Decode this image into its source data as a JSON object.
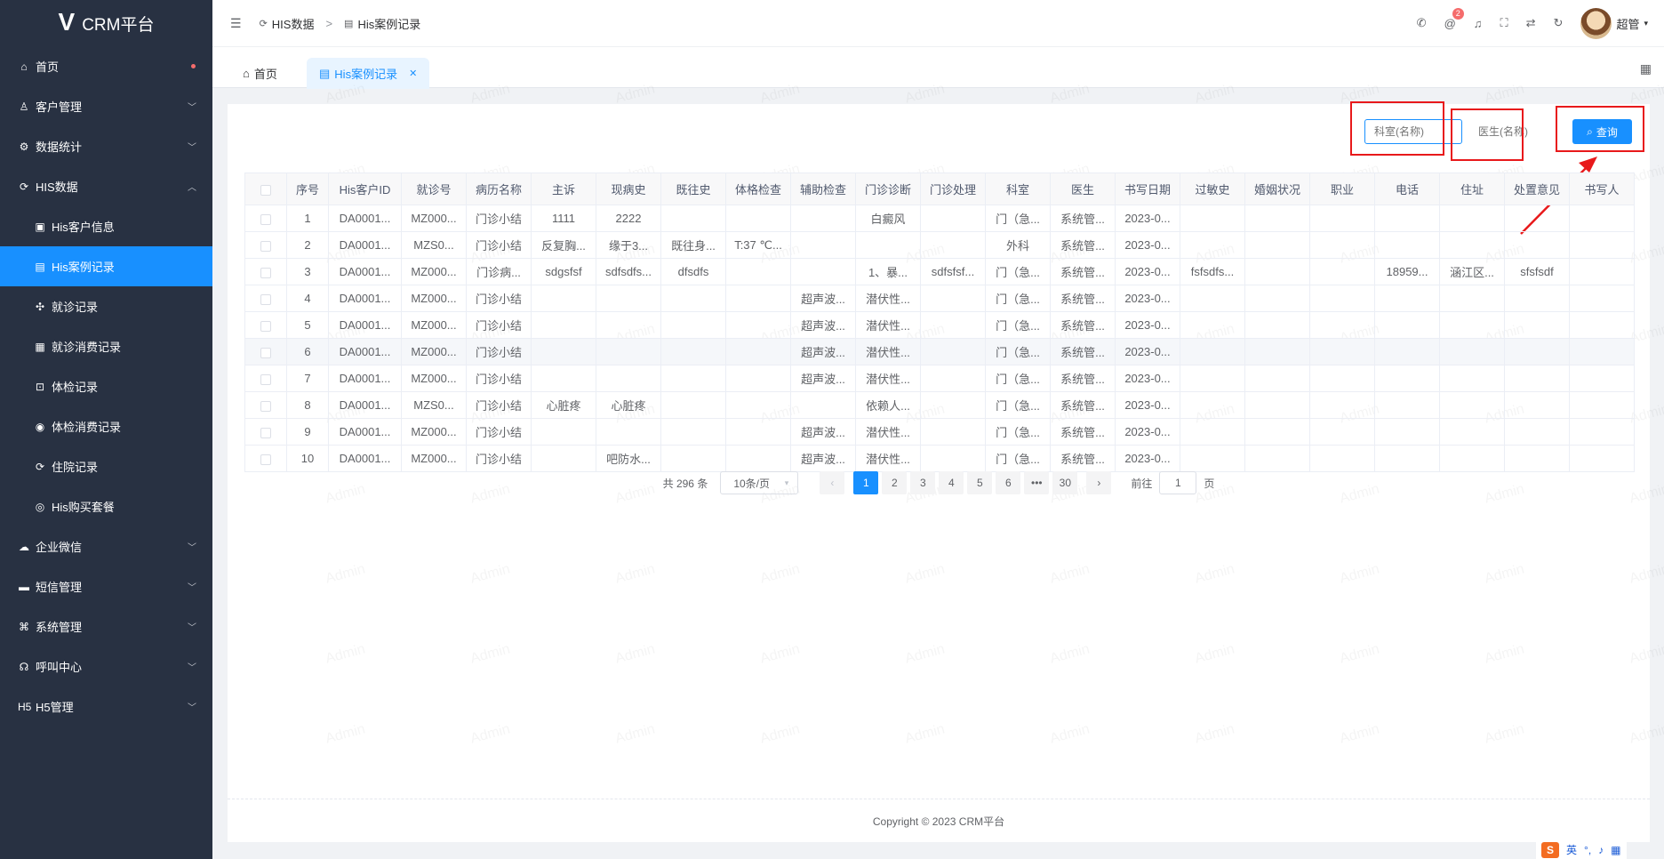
{
  "app": {
    "logo_text": "CRM平台"
  },
  "sidebar": {
    "items": [
      {
        "label": "首页",
        "icon": "home-icon",
        "glyph": "⌂",
        "arrow": "",
        "dot": true,
        "sub": false,
        "active": false
      },
      {
        "label": "客户管理",
        "icon": "user-icon",
        "glyph": "♙",
        "arrow": "down",
        "sub": false,
        "active": false
      },
      {
        "label": "数据统计",
        "icon": "gear-icon",
        "glyph": "⚙",
        "arrow": "down",
        "sub": false,
        "active": false
      },
      {
        "label": "HIS数据",
        "icon": "sync-icon",
        "glyph": "⟳",
        "arrow": "up",
        "sub": false,
        "active": false
      },
      {
        "label": "His客户信息",
        "icon": "id-card-icon",
        "glyph": "▣",
        "arrow": "",
        "sub": true,
        "active": false
      },
      {
        "label": "His案例记录",
        "icon": "document-icon",
        "glyph": "▤",
        "arrow": "",
        "sub": true,
        "active": true
      },
      {
        "label": "就诊记录",
        "icon": "medical-icon",
        "glyph": "✣",
        "arrow": "",
        "sub": true,
        "active": false
      },
      {
        "label": "就诊消费记录",
        "icon": "receipt-icon",
        "glyph": "▦",
        "arrow": "",
        "sub": true,
        "active": false
      },
      {
        "label": "体检记录",
        "icon": "clipboard-icon",
        "glyph": "⊡",
        "arrow": "",
        "sub": true,
        "active": false
      },
      {
        "label": "体检消费记录",
        "icon": "coin-icon",
        "glyph": "◉",
        "arrow": "",
        "sub": true,
        "active": false
      },
      {
        "label": "住院记录",
        "icon": "bed-icon",
        "glyph": "⟳",
        "arrow": "",
        "sub": true,
        "active": false
      },
      {
        "label": "His购买套餐",
        "icon": "package-icon",
        "glyph": "◎",
        "arrow": "",
        "sub": true,
        "active": false
      },
      {
        "label": "企业微信",
        "icon": "wechat-icon",
        "glyph": "☁",
        "arrow": "down",
        "sub": false,
        "active": false
      },
      {
        "label": "短信管理",
        "icon": "message-icon",
        "glyph": "▬",
        "arrow": "down",
        "sub": false,
        "active": false
      },
      {
        "label": "系统管理",
        "icon": "settings-icon",
        "glyph": "⌘",
        "arrow": "down",
        "sub": false,
        "active": false
      },
      {
        "label": "呼叫中心",
        "icon": "headset-icon",
        "glyph": "☊",
        "arrow": "down",
        "sub": false,
        "active": false
      },
      {
        "label": "H5管理",
        "icon": "h5-icon",
        "glyph": "H5",
        "arrow": "down",
        "sub": false,
        "active": false
      }
    ]
  },
  "header": {
    "breadcrumb": [
      "HIS数据",
      "His案例记录"
    ],
    "badge_count": "2",
    "user_name": "超管"
  },
  "tabs": [
    {
      "label": "首页"
    },
    {
      "label": "His案例记录"
    }
  ],
  "search": {
    "department_placeholder": "科室(名称)",
    "doctor_placeholder": "医生(名称)",
    "button_label": "查询"
  },
  "table": {
    "columns": [
      "序号",
      "His客户ID",
      "就诊号",
      "病历名称",
      "主诉",
      "现病史",
      "既往史",
      "体格检查",
      "辅助检查",
      "门诊诊断",
      "门诊处理",
      "科室",
      "医生",
      "书写日期",
      "过敏史",
      "婚姻状况",
      "职业",
      "电话",
      "住址",
      "处置意见",
      "书写人"
    ],
    "rows": [
      [
        "1",
        "DA0001...",
        "MZ000...",
        "门诊小结",
        "1111",
        "2222",
        "",
        "",
        "",
        "白癜风",
        "",
        "门（急...",
        "系统管...",
        "2023-0...",
        "",
        "",
        "",
        "",
        "",
        "",
        ""
      ],
      [
        "2",
        "DA0001...",
        "MZS0...",
        "门诊小结",
        "反复胸...",
        "缘于3...",
        "既往身...",
        "T:37 ℃...",
        "",
        "",
        "",
        "外科",
        "系统管...",
        "2023-0...",
        "",
        "",
        "",
        "",
        "",
        "",
        ""
      ],
      [
        "3",
        "DA0001...",
        "MZ000...",
        "门诊病...",
        "sdgsfsf",
        "sdfsdfs...",
        "dfsdfs",
        "",
        "",
        "1、暴...",
        "sdfsfsf...",
        "门（急...",
        "系统管...",
        "2023-0...",
        "fsfsdfs...",
        "",
        "",
        "18959...",
        "涵江区...",
        "sfsfsdf",
        ""
      ],
      [
        "4",
        "DA0001...",
        "MZ000...",
        "门诊小结",
        "",
        "",
        "",
        "",
        "超声波...",
        "潜伏性...",
        "",
        "门（急...",
        "系统管...",
        "2023-0...",
        "",
        "",
        "",
        "",
        "",
        "",
        ""
      ],
      [
        "5",
        "DA0001...",
        "MZ000...",
        "门诊小结",
        "",
        "",
        "",
        "",
        "超声波...",
        "潜伏性...",
        "",
        "门（急...",
        "系统管...",
        "2023-0...",
        "",
        "",
        "",
        "",
        "",
        "",
        ""
      ],
      [
        "6",
        "DA0001...",
        "MZ000...",
        "门诊小结",
        "",
        "",
        "",
        "",
        "超声波...",
        "潜伏性...",
        "",
        "门（急...",
        "系统管...",
        "2023-0...",
        "",
        "",
        "",
        "",
        "",
        "",
        ""
      ],
      [
        "7",
        "DA0001...",
        "MZ000...",
        "门诊小结",
        "",
        "",
        "",
        "",
        "超声波...",
        "潜伏性...",
        "",
        "门（急...",
        "系统管...",
        "2023-0...",
        "",
        "",
        "",
        "",
        "",
        "",
        ""
      ],
      [
        "8",
        "DA0001...",
        "MZS0...",
        "门诊小结",
        "心脏疼",
        "心脏疼",
        "",
        "",
        "",
        "依赖人...",
        "",
        "门（急...",
        "系统管...",
        "2023-0...",
        "",
        "",
        "",
        "",
        "",
        "",
        ""
      ],
      [
        "9",
        "DA0001...",
        "MZ000...",
        "门诊小结",
        "",
        "",
        "",
        "",
        "超声波...",
        "潜伏性...",
        "",
        "门（急...",
        "系统管...",
        "2023-0...",
        "",
        "",
        "",
        "",
        "",
        "",
        ""
      ],
      [
        "10",
        "DA0001...",
        "MZ000...",
        "门诊小结",
        "",
        "吧防水...",
        "",
        "",
        "超声波...",
        "潜伏性...",
        "",
        "门（急...",
        "系统管...",
        "2023-0...",
        "",
        "",
        "",
        "",
        "",
        "",
        ""
      ]
    ]
  },
  "pagination": {
    "total": "共 296 条",
    "page_size": "10条/页",
    "pages": [
      "1",
      "2",
      "3",
      "4",
      "5",
      "6",
      "•••",
      "30"
    ],
    "current": "1",
    "goto_prefix": "前往",
    "goto_value": "1",
    "goto_suffix": "页"
  },
  "footer": {
    "copyright": "Copyright © 2023 CRM平台"
  },
  "watermark_text": "Admin",
  "ime": {
    "lang": "英"
  },
  "colors": {
    "primary": "#1890ff",
    "sidebar_bg": "#283142",
    "annotation_red": "#e8191b"
  }
}
